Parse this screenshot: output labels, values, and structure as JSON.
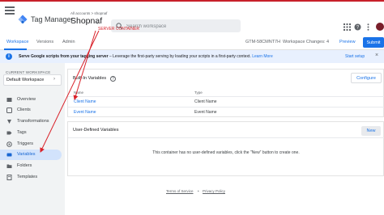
{
  "header": {
    "product_name": "Tag Manager",
    "account_path": "All accounts > shopnaf",
    "container_name": "Shopnaf",
    "search_placeholder": "Search workspace"
  },
  "subnav": {
    "tabs": [
      {
        "label": "Workspace",
        "active": true
      },
      {
        "label": "Versions",
        "active": false
      },
      {
        "label": "Admin",
        "active": false
      }
    ],
    "container_id": "GTM-58CMNT7H",
    "workspace_changes": "Workspace Changes: 4",
    "preview_label": "Preview",
    "submit_label": "Submit"
  },
  "banner": {
    "title": "Serve Google scripts from your tagging server",
    "text": " – Leverage the first-party serving by loading your scripts in a first-party context.",
    "link": "Learn More",
    "setup_label": "Start setup",
    "close_glyph": "×"
  },
  "sidebar": {
    "workspace_label": "CURRENT WORKSPACE",
    "workspace_name": "Default Workspace",
    "items": [
      {
        "label": "Overview",
        "icon": "overview-icon",
        "active": false
      },
      {
        "label": "Clients",
        "icon": "clients-icon",
        "active": false
      },
      {
        "label": "Transformations",
        "icon": "transformations-icon",
        "active": false
      },
      {
        "label": "Tags",
        "icon": "tag-icon",
        "active": false
      },
      {
        "label": "Triggers",
        "icon": "trigger-icon",
        "active": false
      },
      {
        "label": "Variables",
        "icon": "variables-icon",
        "active": true
      },
      {
        "label": "Folders",
        "icon": "folder-icon",
        "active": false
      },
      {
        "label": "Templates",
        "icon": "templates-icon",
        "active": false
      }
    ]
  },
  "builtin": {
    "title": "Built-In Variables",
    "configure_label": "Configure",
    "col_name": "Name",
    "col_type": "Type",
    "rows": [
      {
        "name": "Client Name",
        "type": "Client Name"
      },
      {
        "name": "Event Name",
        "type": "Event Name"
      }
    ]
  },
  "user_defined": {
    "title": "User-Defined Variables",
    "new_label": "New",
    "empty_message": "This container has no user-defined variables, click the \"New\" button to create one."
  },
  "footer": {
    "terms": "Terms of Service",
    "separator": "•",
    "privacy": "Privacy Policy"
  },
  "annotation": {
    "label": "SERVER CONTAINER",
    "color": "#d9222a"
  },
  "colors": {
    "accent": "#1a73e8",
    "active_nav_bg": "#d2e3fc",
    "banner_bg": "#e8f0fe",
    "top_line": "#c8202a"
  }
}
